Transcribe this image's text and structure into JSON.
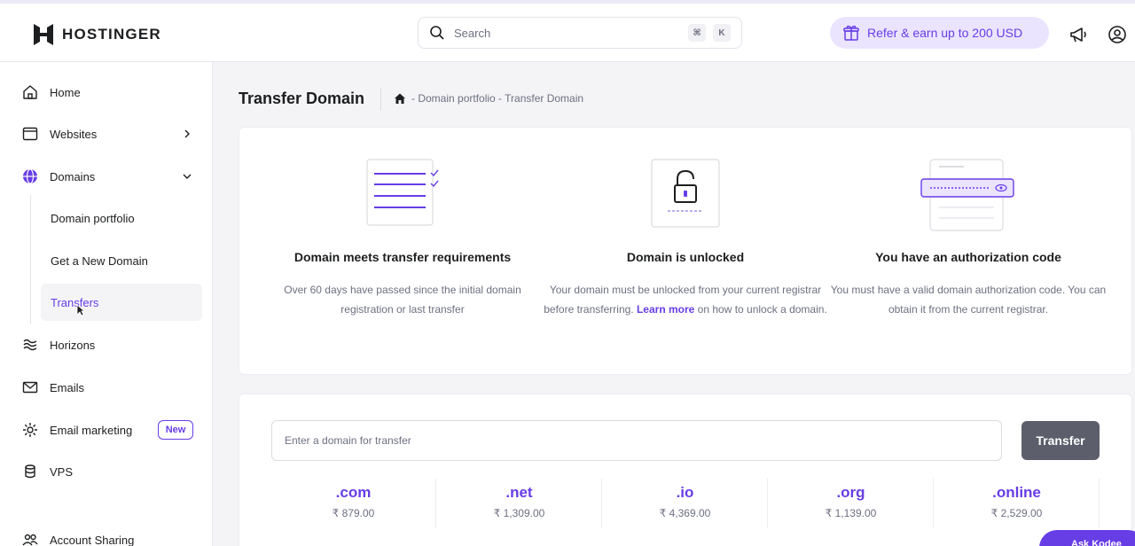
{
  "header": {
    "logo_text": "HOSTINGER",
    "search_placeholder": "Search",
    "search_shortcut_1": "⌘",
    "search_shortcut_2": "K",
    "refer_label": "Refer & earn up to 200 USD"
  },
  "sidebar": {
    "items": [
      {
        "label": "Home",
        "icon": "home-icon"
      },
      {
        "label": "Websites",
        "icon": "websites-icon"
      },
      {
        "label": "Domains",
        "icon": "globe-icon"
      },
      {
        "label": "Horizons",
        "icon": "horizons-icon"
      },
      {
        "label": "Emails",
        "icon": "mail-icon"
      },
      {
        "label": "Email marketing",
        "icon": "email-marketing-icon",
        "badge": "New"
      },
      {
        "label": "VPS",
        "icon": "server-icon"
      },
      {
        "label": "Account Sharing",
        "icon": "users-icon"
      }
    ],
    "domains_sub": [
      {
        "label": "Domain portfolio"
      },
      {
        "label": "Get a New Domain"
      },
      {
        "label": "Transfers"
      }
    ]
  },
  "main": {
    "title": "Transfer Domain",
    "breadcrumb": "- Domain portfolio - Transfer Domain",
    "requirements": [
      {
        "title": "Domain meets transfer requirements",
        "text": "Over 60 days have passed since the initial domain registration or last transfer"
      },
      {
        "title": "Domain is unlocked",
        "text_before": "Your domain must be unlocked from your current registrar before transferring.",
        "link": "Learn more",
        "text_after": "on how to unlock a domain."
      },
      {
        "title": "You have an authorization code",
        "text": "You must have a valid domain authorization code. You can obtain it from the current registrar."
      }
    ],
    "domain_input_placeholder": "Enter a domain for transfer",
    "transfer_button": "Transfer",
    "tlds": [
      {
        "name": ".com",
        "price": "₹ 879.00"
      },
      {
        "name": ".net",
        "price": "₹ 1,309.00"
      },
      {
        "name": ".io",
        "price": "₹ 4,369.00"
      },
      {
        "name": ".org",
        "price": "₹ 1,139.00"
      },
      {
        "name": ".online",
        "price": "₹ 2,529.00"
      }
    ],
    "kodee_label": "Ask Kodee"
  },
  "colors": {
    "accent": "#673de6",
    "accent_soft": "#ebe4ff",
    "button_gray": "#5c5f6b"
  }
}
